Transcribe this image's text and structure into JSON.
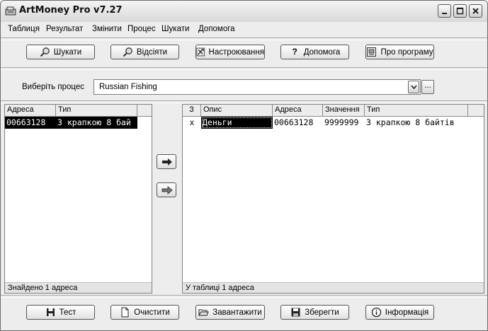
{
  "window": {
    "title": "ArtMoney Pro v7.27"
  },
  "menu": [
    "Таблиця",
    "Результат",
    "Змінити",
    "Процес",
    "Шукати",
    "Допомога"
  ],
  "toolbar": {
    "search": "Шукати",
    "filter": "Відсіяти",
    "settings": "Настроювання",
    "help": "Допомога",
    "about": "Про програму"
  },
  "process": {
    "label": "Виберіть процес",
    "selected": "Russian Fishing",
    "browse": "..."
  },
  "left_table": {
    "columns": [
      "Адреса",
      "Тип"
    ],
    "rows": [
      {
        "address": "00663128",
        "type": "З крапкою 8 бай"
      }
    ],
    "status": "Знайдено 1 адреса"
  },
  "right_table": {
    "columns": [
      "З",
      "Опис",
      "Адреса",
      "Значення",
      "Тип"
    ],
    "rows": [
      {
        "freeze": "x",
        "description": "Деньги",
        "address": "00663128",
        "value": "9999999",
        "type": "З крапкою 8 байтів"
      }
    ],
    "status": "У таблиці 1 адреса"
  },
  "bottom": {
    "test": "Тест",
    "clear": "Очистити",
    "load": "Завантажити",
    "save": "Зберегти",
    "info": "Інформація"
  },
  "icons": {
    "add_selected": "arrow-right-icon",
    "add_all": "arrow-right-all-icon"
  }
}
